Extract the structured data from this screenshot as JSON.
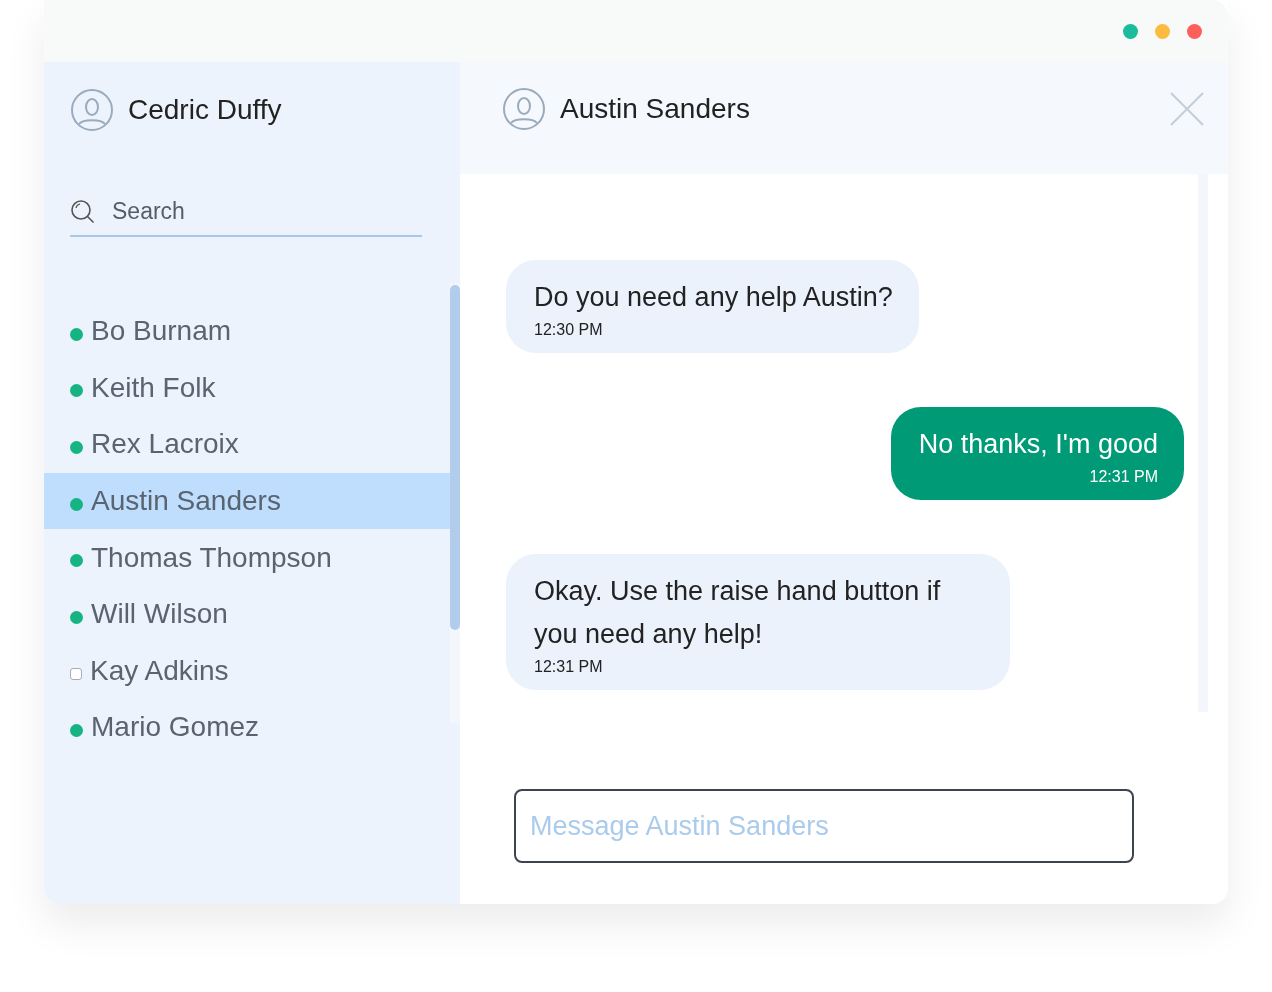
{
  "window": {
    "controls": [
      {
        "color": "#1abc9c"
      },
      {
        "color": "#fdbc40"
      },
      {
        "color": "#fc605c"
      }
    ]
  },
  "sidebar": {
    "user": "Cedric Duffy",
    "search": {
      "placeholder": "Search"
    },
    "contacts": [
      {
        "name": "Bo Burnam",
        "online": true,
        "selected": false
      },
      {
        "name": "Keith Folk",
        "online": true,
        "selected": false
      },
      {
        "name": "Rex Lacroix",
        "online": true,
        "selected": false
      },
      {
        "name": "Austin Sanders",
        "online": true,
        "selected": true
      },
      {
        "name": "Thomas Thompson",
        "online": true,
        "selected": false
      },
      {
        "name": "Will Wilson",
        "online": true,
        "selected": false
      },
      {
        "name": "Kay Adkins",
        "online": false,
        "selected": false
      },
      {
        "name": "Mario Gomez",
        "online": true,
        "selected": false
      }
    ]
  },
  "chat": {
    "title": "Austin Sanders",
    "messages": [
      {
        "kind": "incoming",
        "text": "Do you need any help Austin?",
        "time": "12:30 PM"
      },
      {
        "kind": "outgoing",
        "text": "No thanks, I'm good",
        "time": "12:31 PM"
      },
      {
        "kind": "incoming",
        "text": "Okay. Use the raise hand button if you need any help!",
        "time": "12:31 PM"
      }
    ],
    "composer": {
      "placeholder": "Message Austin Sanders"
    }
  }
}
